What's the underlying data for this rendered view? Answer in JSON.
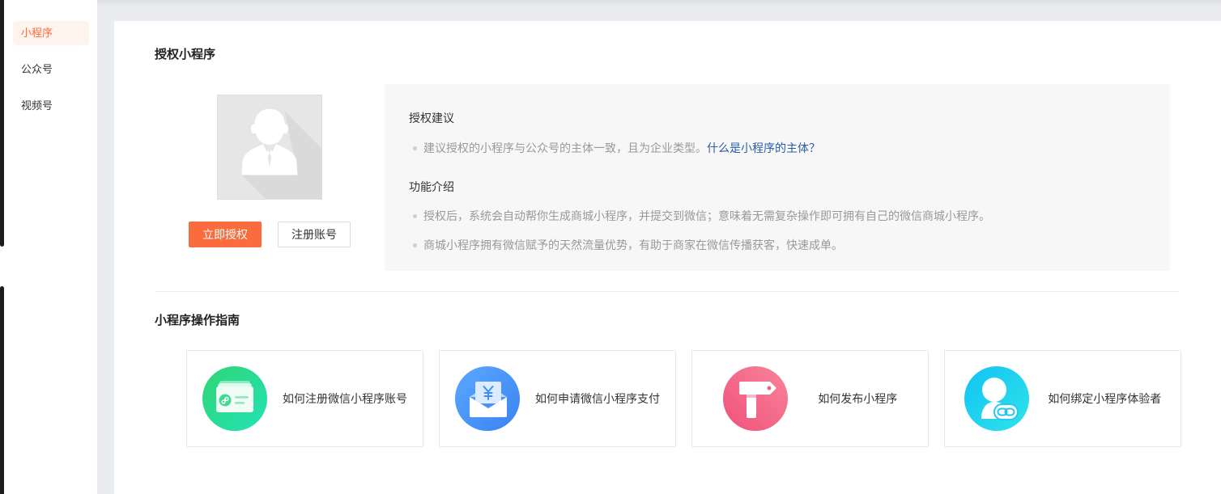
{
  "sidebar": {
    "items": [
      {
        "label": "小程序",
        "active": true
      },
      {
        "label": "公众号",
        "active": false
      },
      {
        "label": "视频号",
        "active": false
      }
    ]
  },
  "authorize_section": {
    "title": "授权小程序",
    "avatar_icon": "user-placeholder-icon",
    "authorize_button": "立即授权",
    "register_button": "注册账号",
    "suggestion": {
      "heading": "授权建议",
      "text": "建议授权的小程序与公众号的主体一致，且为企业类型。",
      "link": "什么是小程序的主体？"
    },
    "features": {
      "heading": "功能介绍",
      "items": [
        "授权后，系统会自动帮你生成商城小程序，并提交到微信；意味着无需复杂操作即可拥有自己的微信商城小程序。",
        "商城小程序拥有微信赋予的天然流量优势，有助于商家在微信传播获客，快速成单。"
      ]
    }
  },
  "guide_section": {
    "title": "小程序操作指南",
    "cards": [
      {
        "label": "如何注册微信小程序账号",
        "icon": "mini-program-card-icon",
        "gradient_from": "#2fd574",
        "gradient_to": "#23e2b6"
      },
      {
        "label": "如何申请微信小程序支付",
        "icon": "payment-envelope-icon",
        "gradient_from": "#5aa9ff",
        "gradient_to": "#3b82f3"
      },
      {
        "label": "如何发布小程序",
        "icon": "signpost-icon",
        "gradient_from": "#f0517a",
        "gradient_to": "#f8849b"
      },
      {
        "label": "如何绑定小程序体验者",
        "icon": "user-link-icon",
        "gradient_from": "#12c2f4",
        "gradient_to": "#2fe4e8"
      }
    ]
  },
  "colors": {
    "accent": "#fa6c3e",
    "accent_soft": "#fff3ed",
    "link": "#2a5caa",
    "page_bg": "#ebecef",
    "panel_bg": "#f7f7f7",
    "border": "#dcdcdc"
  }
}
